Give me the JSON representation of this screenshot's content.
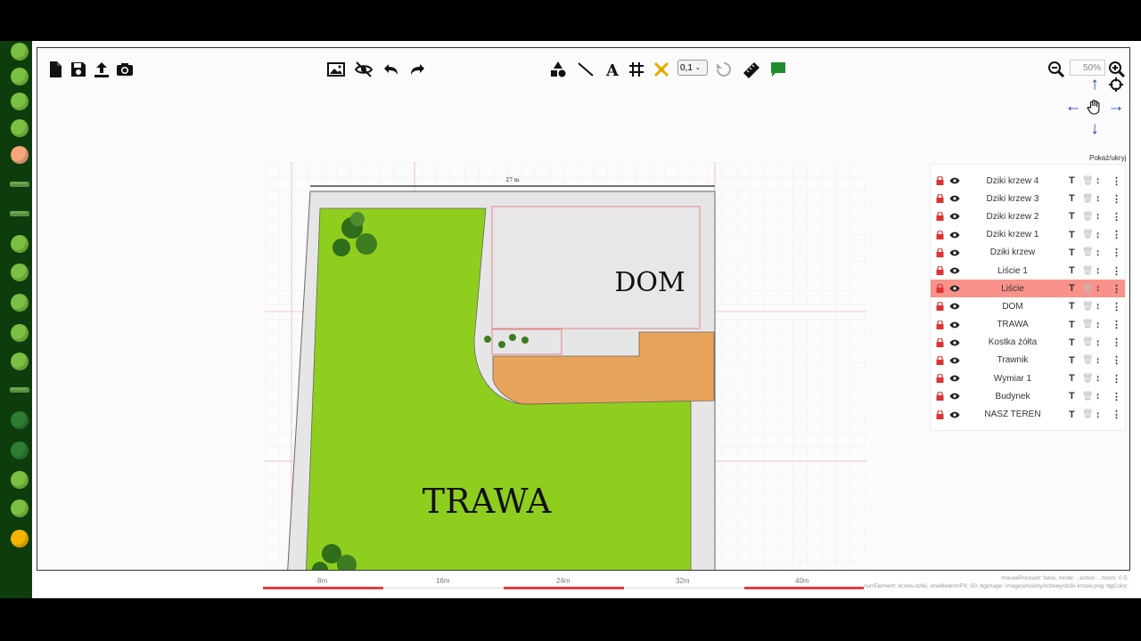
{
  "toolbar": {
    "precision_value": "0,1",
    "zoom_value": "50%"
  },
  "nav": {
    "toggle_label": "Pokaż/ukryj"
  },
  "plan": {
    "dimension_label": "27 m",
    "house_label": "DOM",
    "grass_label": "TRAWA"
  },
  "layers": [
    {
      "name": "Dziki krzew 4",
      "active": false
    },
    {
      "name": "Dziki krzew 3",
      "active": false
    },
    {
      "name": "Dziki krzew 2",
      "active": false
    },
    {
      "name": "Dziki krzew 1",
      "active": false
    },
    {
      "name": "Dziki krzew",
      "active": false
    },
    {
      "name": "Liście 1",
      "active": false
    },
    {
      "name": "Liście",
      "active": true
    },
    {
      "name": "DOM",
      "active": false
    },
    {
      "name": "TRAWA",
      "active": false
    },
    {
      "name": "Kostka żółta",
      "active": false
    },
    {
      "name": "Trawnik",
      "active": false
    },
    {
      "name": "Wymiar 1",
      "active": false
    },
    {
      "name": "Budynek",
      "active": false
    },
    {
      "name": "NASZ TEREN",
      "active": false
    }
  ],
  "scale": {
    "labels": [
      "8m",
      "16m",
      "24m",
      "32m",
      "40m"
    ]
  },
  "status": {
    "line1": "mousePressed: false, mode: , action: , zoom: 0.5,",
    "line2": "currElement: krzew-dziki, oneMeterInPX: 50, bgimage: images/rosliny/krzewy/dziki-krzew.png, bgColor:"
  },
  "colors": {
    "grass": "#8fce1e",
    "paving": "#e8a45a",
    "house": "#e8e6e8",
    "active_layer": "#f8928a",
    "nav_arrow": "#1a3ccf",
    "palette_bg": "#0d3d0d"
  }
}
